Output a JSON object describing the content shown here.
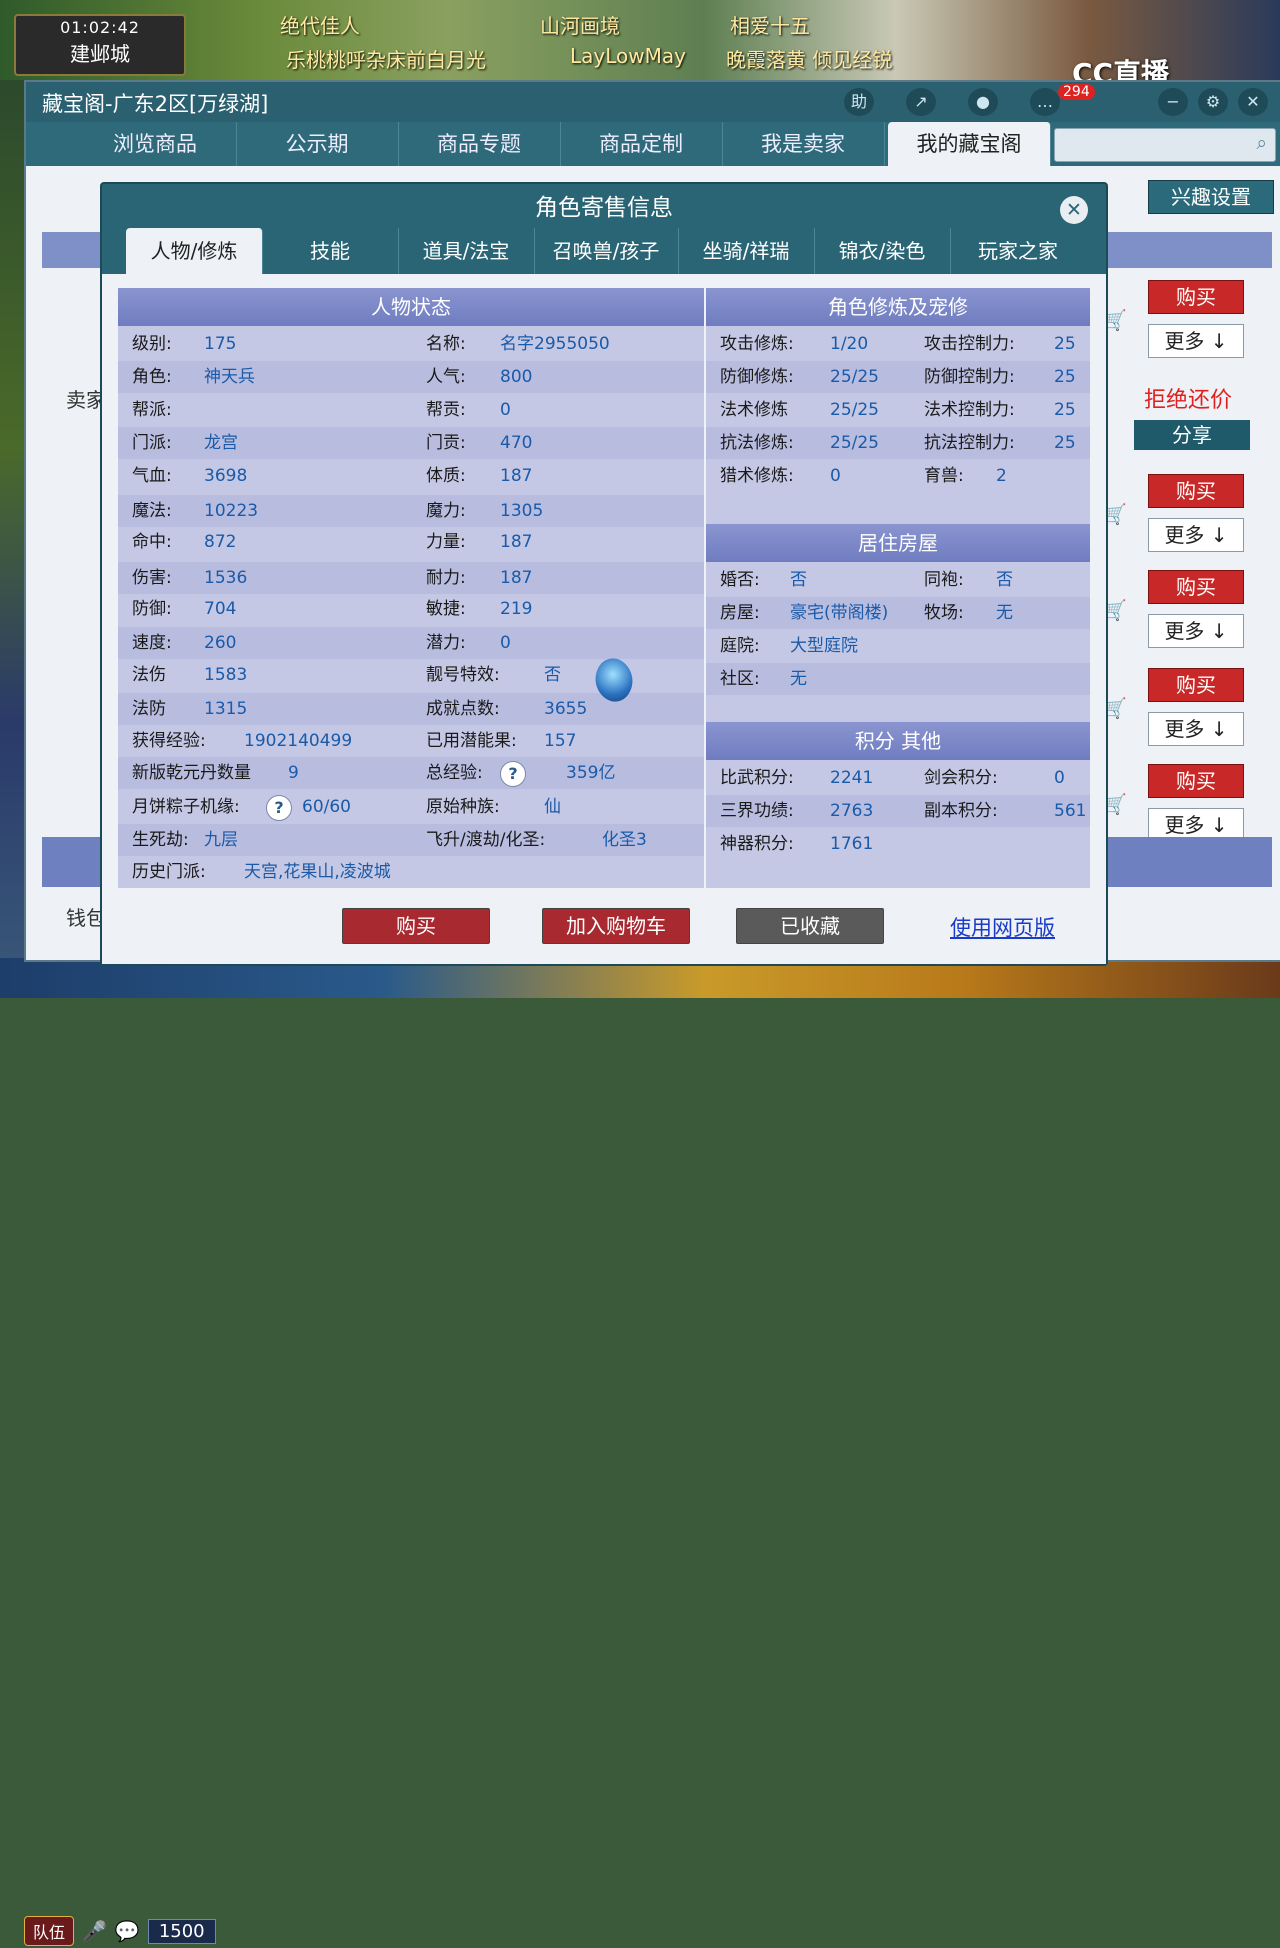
{
  "game": {
    "clock": "01:02:42",
    "city": "建邺城",
    "captions": [
      "绝代佳人",
      "乐桃桃呼杂床前白月光",
      "山河画境",
      "LayLowMay",
      "相爱十五",
      "晚霞落黄 倾见经锐"
    ],
    "stream_logo": "CC直播",
    "hud_team": "队伍",
    "hud_counter": "1500"
  },
  "shop": {
    "title": "藏宝阁-广东2区[万绿湖]",
    "titlebar_buttons": [
      "助",
      "↗",
      "●",
      "…",
      "✕"
    ],
    "badge_count": "294",
    "nav_tabs": [
      "浏览商品",
      "公示期",
      "商品专题",
      "商品定制",
      "我是卖家",
      "我的藏宝阁"
    ],
    "interest_button": "兴趣设置",
    "reject_bargain": "拒绝还价",
    "share_button": "分享",
    "buy_label": "购买",
    "more_label": "更多 ↓",
    "seller_label": "卖家",
    "money_label": "钱包"
  },
  "modal": {
    "title": "角色寄售信息",
    "close_icon": "close-icon",
    "tabs": [
      "人物/修炼",
      "技能",
      "道具/法宝",
      "召唤兽/孩子",
      "坐骑/祥瑞",
      "锦衣/染色",
      "玩家之家"
    ],
    "status": {
      "heading": "人物状态",
      "left": [
        {
          "label": "级别:",
          "value": "175"
        },
        {
          "label": "角色:",
          "value": "神天兵"
        },
        {
          "label": "帮派:",
          "value": ""
        },
        {
          "label": "门派:",
          "value": "龙宫"
        },
        {
          "label": "气血:",
          "value": "3698"
        },
        {
          "label": "魔法:",
          "value": "10223"
        },
        {
          "label": "命中:",
          "value": "872"
        },
        {
          "label": "伤害:",
          "value": "1536"
        },
        {
          "label": "防御:",
          "value": "704"
        },
        {
          "label": "速度:",
          "value": "260"
        },
        {
          "label": "法伤",
          "value": "1583"
        },
        {
          "label": "法防",
          "value": "1315"
        },
        {
          "label": "获得经验:",
          "value": "1902140499"
        },
        {
          "label": "新版乾元丹数量",
          "value": "9"
        },
        {
          "label": "月饼粽子机缘:",
          "value": "60/60"
        },
        {
          "label": "生死劫:",
          "value": "九层"
        },
        {
          "label": "历史门派:",
          "value": "天宫,花果山,凌波城"
        }
      ],
      "right": [
        {
          "label": "名称:",
          "value": "名字2955050"
        },
        {
          "label": "人气:",
          "value": "800"
        },
        {
          "label": "帮贡:",
          "value": "0"
        },
        {
          "label": "门贡:",
          "value": "470"
        },
        {
          "label": "体质:",
          "value": "187"
        },
        {
          "label": "魔力:",
          "value": "1305"
        },
        {
          "label": "力量:",
          "value": "187"
        },
        {
          "label": "耐力:",
          "value": "187"
        },
        {
          "label": "敏捷:",
          "value": "219"
        },
        {
          "label": "潜力:",
          "value": "0"
        },
        {
          "label": "靓号特效:",
          "value": "否"
        },
        {
          "label": "成就点数:",
          "value": "3655"
        },
        {
          "label": "已用潜能果:",
          "value": "157"
        },
        {
          "label": "总经验:",
          "value": "359亿"
        },
        {
          "label": "原始种族:",
          "value": "仙"
        },
        {
          "label": "飞升/渡劫/化圣:",
          "value": "化圣3"
        }
      ]
    },
    "cultivation": {
      "heading": "角色修炼及宠修",
      "rows": [
        {
          "l1": "攻击修炼:",
          "v1": "1/20",
          "l2": "攻击控制力:",
          "v2": "25"
        },
        {
          "l1": "防御修炼:",
          "v1": "25/25",
          "l2": "防御控制力:",
          "v2": "25"
        },
        {
          "l1": "法术修炼",
          "v1": "25/25",
          "l2": "法术控制力:",
          "v2": "25"
        },
        {
          "l1": "抗法修炼:",
          "v1": "25/25",
          "l2": "抗法控制力:",
          "v2": "25"
        },
        {
          "l1": "猎术修炼:",
          "v1": "0",
          "l2": "育兽:",
          "v2": "2"
        }
      ]
    },
    "housing": {
      "heading": "居住房屋",
      "rows": [
        {
          "l1": "婚否:",
          "v1": "否",
          "l2": "同袍:",
          "v2": "否"
        },
        {
          "l1": "房屋:",
          "v1": "豪宅(带阁楼)",
          "l2": "牧场:",
          "v2": "无"
        },
        {
          "l1": "庭院:",
          "v1": "大型庭院",
          "l2": "",
          "v2": ""
        },
        {
          "l1": "社区:",
          "v1": "无",
          "l2": "",
          "v2": ""
        }
      ]
    },
    "points": {
      "heading": "积分 其他",
      "rows": [
        {
          "l1": "比武积分:",
          "v1": "2241",
          "l2": "剑会积分:",
          "v2": "0"
        },
        {
          "l1": "三界功绩:",
          "v1": "2763",
          "l2": "副本积分:",
          "v2": "561"
        },
        {
          "l1": "神器积分:",
          "v1": "1761",
          "l2": "",
          "v2": ""
        }
      ]
    },
    "buttons": {
      "buy": "购买",
      "cart": "加入购物车",
      "favorited": "已收藏",
      "web": "使用网页版"
    },
    "help_mark": "?"
  }
}
